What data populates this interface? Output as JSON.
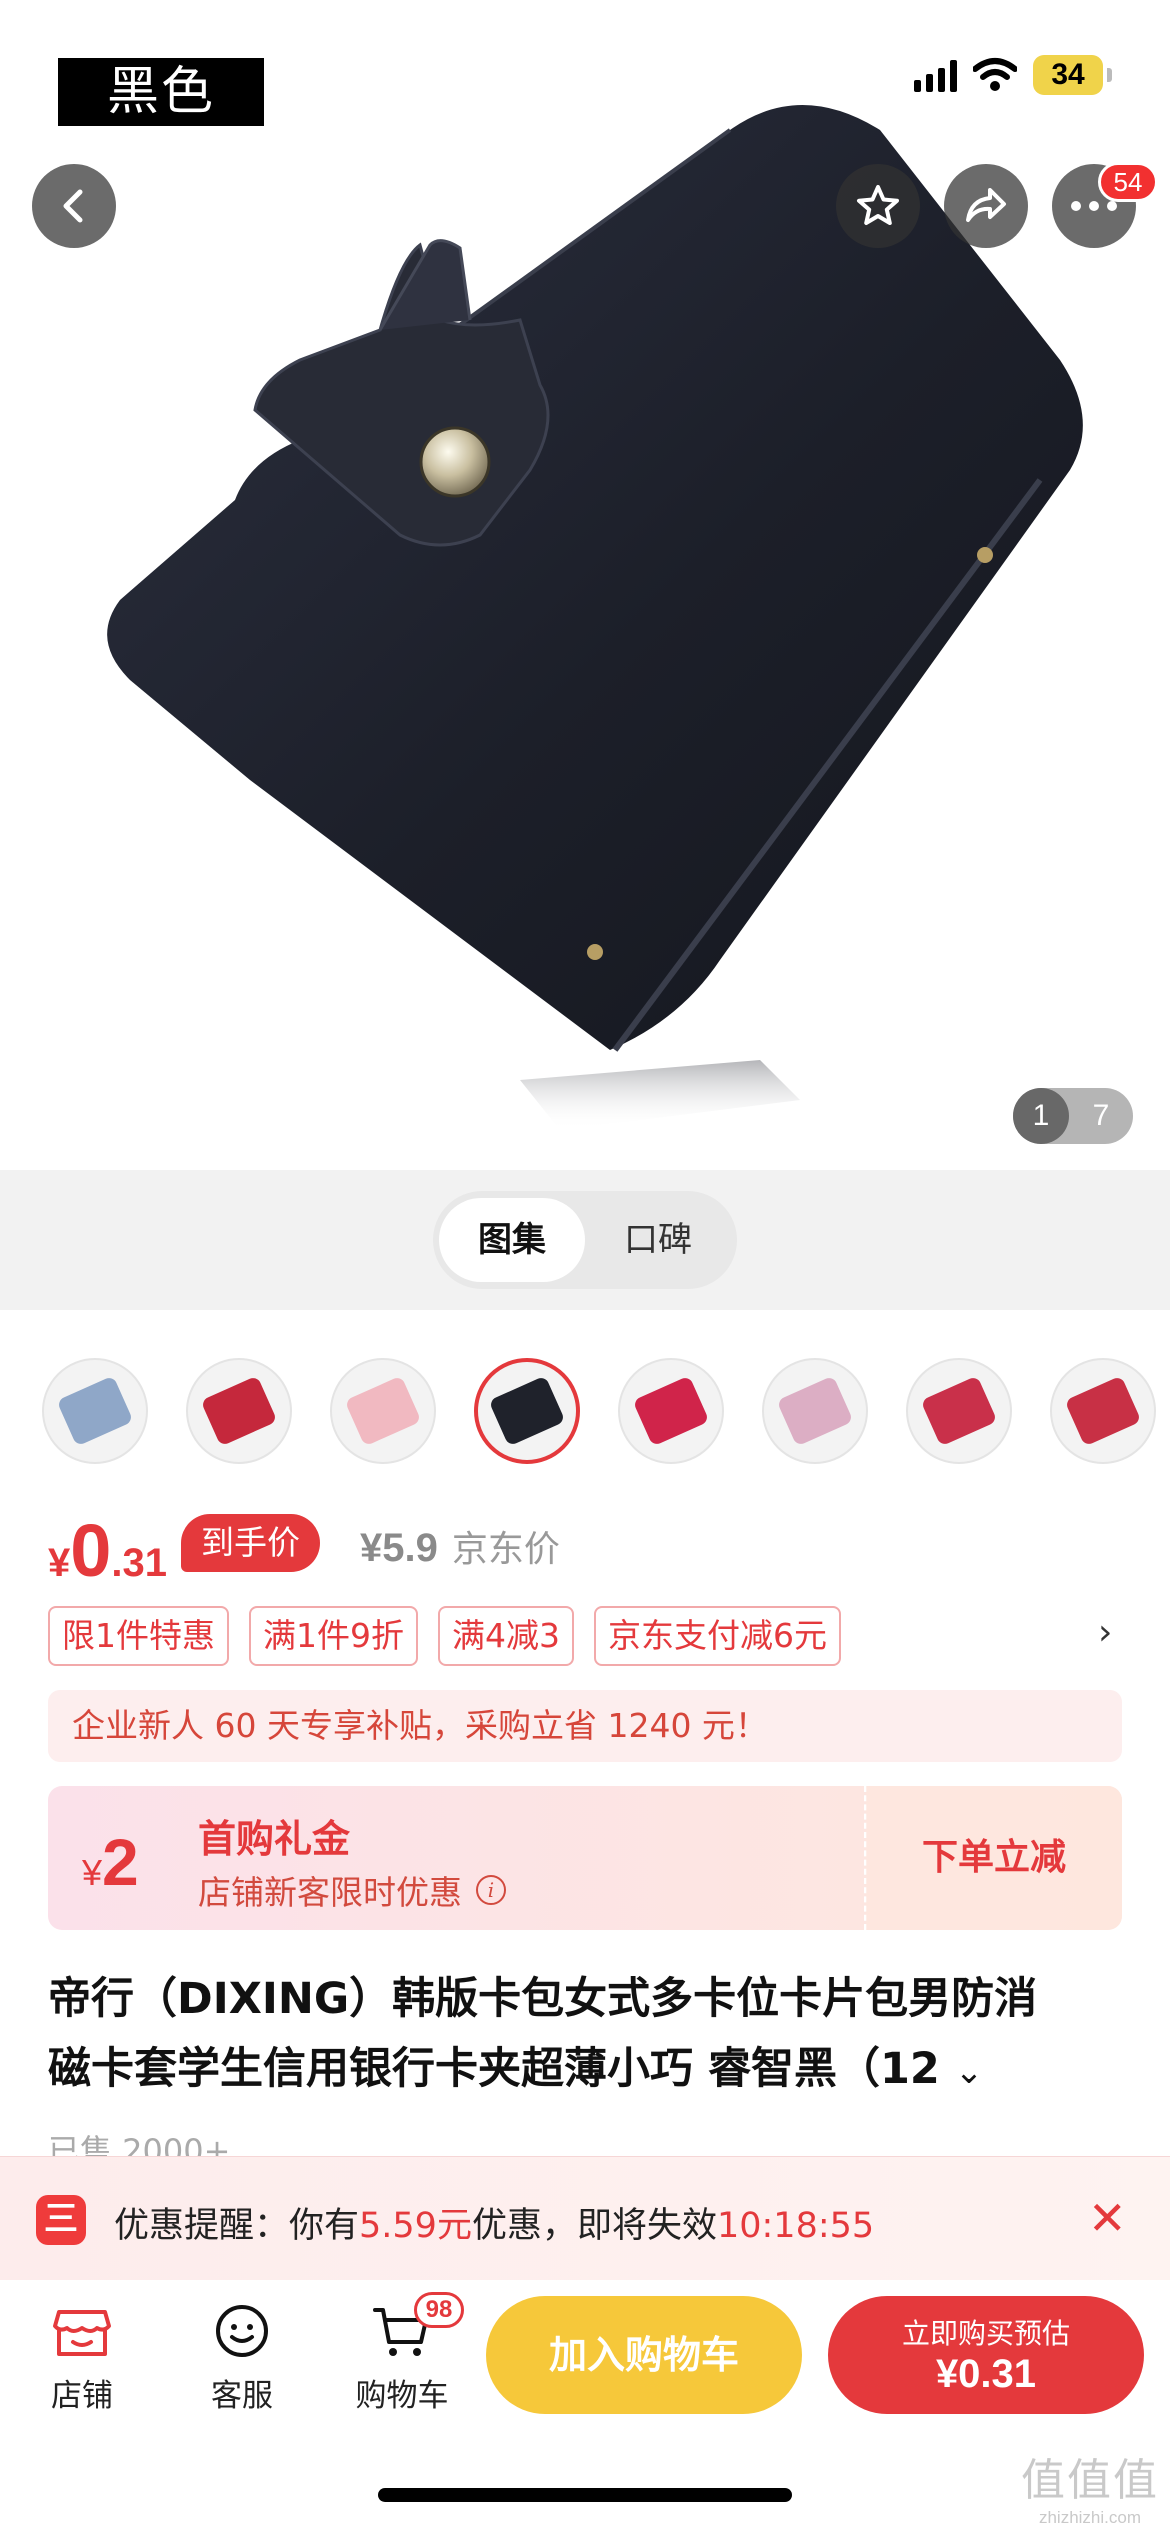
{
  "status_bar": {
    "battery": "34"
  },
  "overlay_label": "黑色",
  "hero": {
    "current_page": "1",
    "total_pages": "7",
    "more_badge": "54"
  },
  "toggle": {
    "tabs": [
      "图集",
      "口碑"
    ],
    "active_index": 0
  },
  "thumbnails": [
    {
      "color": "#8fa7c8"
    },
    {
      "color": "#c5283c"
    },
    {
      "color": "#f1b9c1"
    },
    {
      "color": "#1f222b"
    },
    {
      "color": "#d0244a"
    },
    {
      "color": "#dcaec4"
    },
    {
      "color": "#c9304a"
    },
    {
      "color": "#c83045"
    }
  ],
  "price": {
    "currency": "¥",
    "integer": "0",
    "decimal": ".31",
    "to_hand_label": "到手价",
    "jd_price": "¥5.9",
    "jd_price_label": "京东价"
  },
  "promos": [
    "限1件特惠",
    "满1件9折",
    "满4减3",
    "京东支付减6元"
  ],
  "promo_more": "›",
  "new_user_banner": "企业新人 60 天专享补贴，采购立省 1240 元！",
  "gift": {
    "currency": "¥",
    "amount": "2",
    "title": "首购礼金",
    "subtitle": "店铺新客限时优惠",
    "info_icon": "i",
    "cta": "下单立减"
  },
  "product": {
    "title_line1": "帝行（DIXING）韩版卡包女式多卡位卡片包男防消",
    "title_line2": "磁卡套学生信用银行卡夹超薄小巧 睿智黑（12",
    "expand_icon": "⌄",
    "sold": "已售 2000+"
  },
  "reminder": {
    "logo": "三",
    "prefix": "优惠提醒：你有",
    "amount": "5.59元",
    "middle": "优惠，即将失效",
    "countdown": "10:18:55",
    "close": "✕"
  },
  "bottom_nav": {
    "shop": "店铺",
    "service": "客服",
    "cart": "购物车",
    "cart_badge": "98",
    "add_to_cart": "加入购物车",
    "buy_line1": "立即购买预估",
    "buy_line2": "¥0.31"
  },
  "watermark": {
    "text": "值值值",
    "url": "zhizhizhi.com"
  },
  "colors": {
    "accent": "#e4393c",
    "cart_button": "#f6c83a",
    "wallet": "#1f222b"
  }
}
